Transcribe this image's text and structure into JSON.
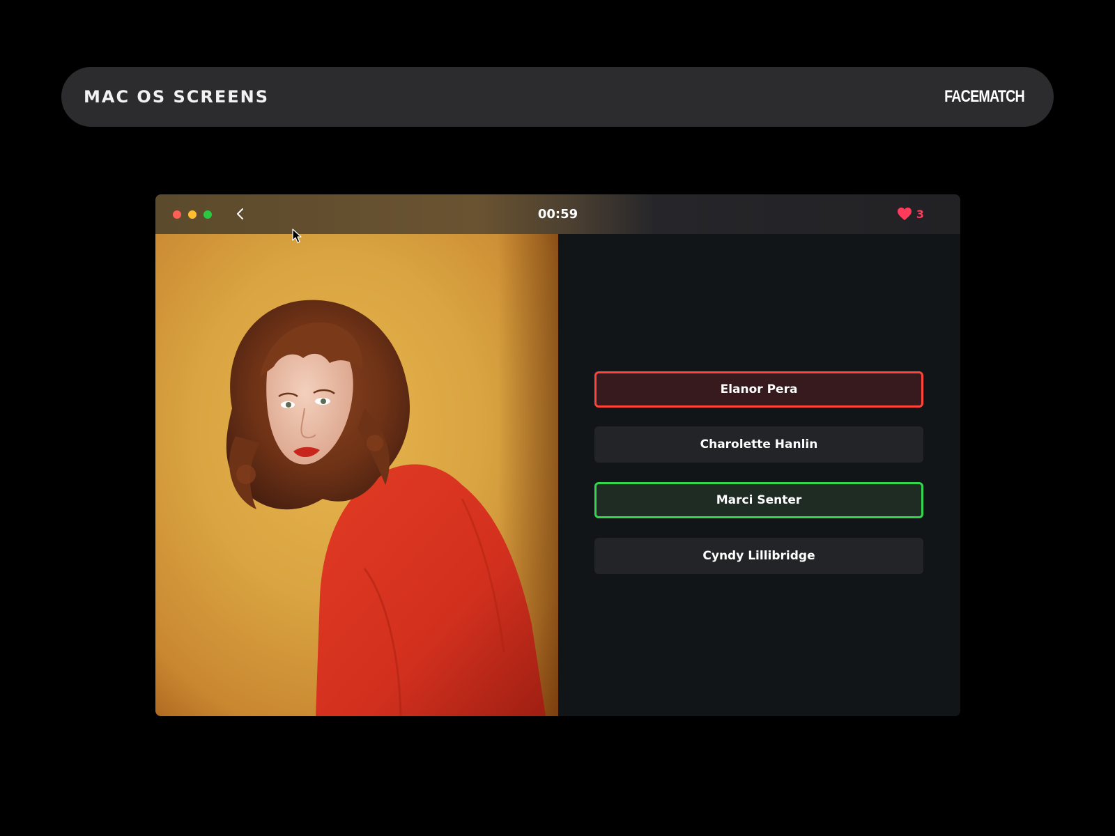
{
  "banner": {
    "title": "MAC OS SCREENS",
    "brand": "FACEMATCH"
  },
  "window": {
    "controls": [
      "close",
      "minimize",
      "zoom"
    ],
    "back_icon": "chevron-left-icon",
    "timer": "00:59",
    "lives": {
      "icon": "heart-icon",
      "count": "3",
      "color": "#ff3b5c"
    }
  },
  "photo": {
    "description_icon": "portrait-photo",
    "background_color": "#d9a441",
    "sweater_color": "#d2301e"
  },
  "answers": [
    {
      "label": "Elanor Pera",
      "state": "wrong",
      "border_color": "#ff453a"
    },
    {
      "label": "Charolette Hanlin",
      "state": "neutral"
    },
    {
      "label": "Marci Senter",
      "state": "correct",
      "border_color": "#32d74b"
    },
    {
      "label": "Cyndy Lillibridge",
      "state": "neutral"
    }
  ]
}
